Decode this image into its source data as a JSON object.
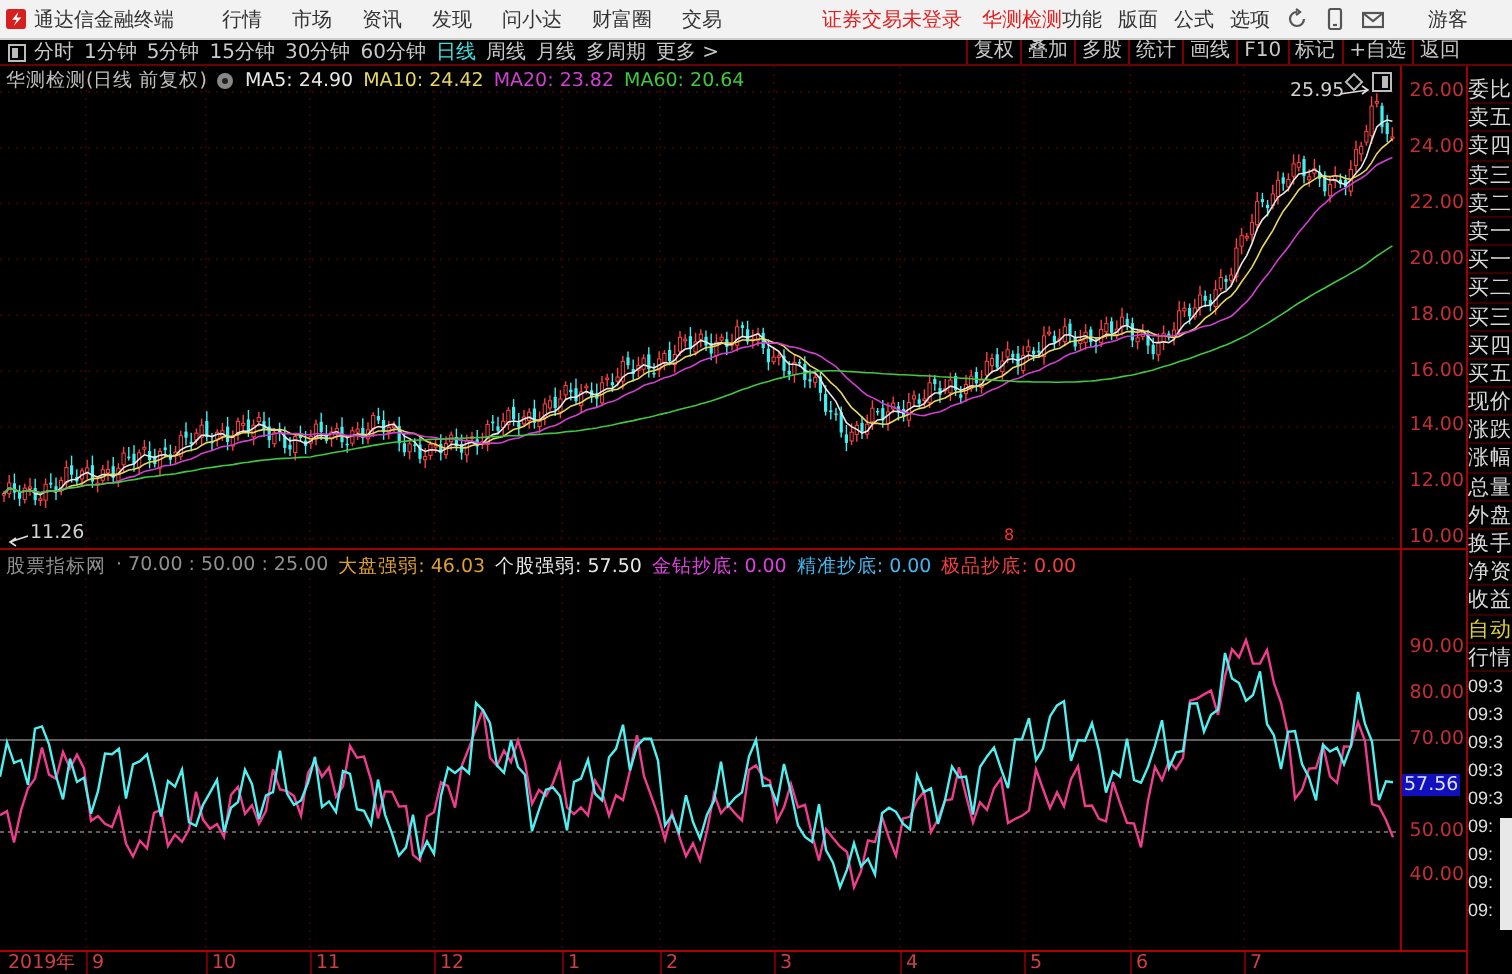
{
  "menu_bar": {
    "app_title": "通达信金融终端",
    "menus": [
      "行情",
      "市场",
      "资讯",
      "发现",
      "问小达",
      "财富圈",
      "交易"
    ],
    "login_status": "证券交易未登录",
    "stock_name": "华测检测",
    "tools": [
      "功能",
      "版面",
      "公式",
      "选项"
    ],
    "user": "游客"
  },
  "period_tabs": [
    {
      "label": "分时",
      "selected": false
    },
    {
      "label": "1分钟",
      "selected": false
    },
    {
      "label": "5分钟",
      "selected": false
    },
    {
      "label": "15分钟",
      "selected": false
    },
    {
      "label": "30分钟",
      "selected": false
    },
    {
      "label": "60分钟",
      "selected": false
    },
    {
      "label": "日线",
      "selected": true
    },
    {
      "label": "周线",
      "selected": false
    },
    {
      "label": "月线",
      "selected": false
    },
    {
      "label": "多周期",
      "selected": false
    },
    {
      "label": "更多 >",
      "selected": false
    }
  ],
  "chart_tools": [
    "复权",
    "叠加",
    "多股",
    "统计",
    "画线",
    "F10",
    "标记",
    "+自选",
    "返回"
  ],
  "price_chart": {
    "title": "华测检测(日线 前复权)",
    "ma_legend": [
      {
        "label": "MA5: 24.90",
        "color": "#e8e8e8"
      },
      {
        "label": "MA10: 24.42",
        "color": "#e8d860"
      },
      {
        "label": "MA20: 23.82",
        "color": "#d040d0"
      },
      {
        "label": "MA60: 20.64",
        "color": "#40c840"
      }
    ],
    "y_ticks": [
      "26.00",
      "24.00",
      "22.00",
      "20.00",
      "18.00",
      "16.00",
      "14.00",
      "12.00",
      "10.00"
    ],
    "high_label": "25.95",
    "low_label": "11.26",
    "signal_mark": "8"
  },
  "indicator_chart": {
    "name": "股票指标网",
    "levels": "· 70.00 : 50.00 : 25.00",
    "legend": [
      {
        "label": "大盘强弱: 46.03",
        "color": "#e0a030"
      },
      {
        "label": "个股强弱: 57.50",
        "color": "#e8e8e8"
      },
      {
        "label": "金钻抄底: 0.00",
        "color": "#e040e0"
      },
      {
        "label": "精准抄底: 0.00",
        "color": "#40b8f0"
      },
      {
        "label": "极品抄底: 0.00",
        "color": "#f04040"
      }
    ],
    "y_ticks": [
      "90.00",
      "80.00",
      "70.00",
      "50.00",
      "40.00"
    ],
    "current_value": "57.56"
  },
  "time_axis": [
    "2019年",
    "9",
    "10",
    "11",
    "12",
    "1",
    "2",
    "3",
    "4",
    "5",
    "6",
    "7"
  ],
  "quote_panel": {
    "fields": [
      "委比",
      "卖五",
      "卖四",
      "卖三",
      "卖二",
      "卖一",
      "买一",
      "买二",
      "买三",
      "买四",
      "买五",
      "现价",
      "涨跌",
      "涨幅",
      "总量",
      "外盘",
      "换手",
      "净资",
      "收益"
    ],
    "auto_label": "自动",
    "quote_label": "行情",
    "times": [
      "09:3",
      "09:3",
      "09:3",
      "09:3",
      "09:3",
      "09:",
      "09:",
      "09:",
      "09:"
    ]
  }
}
